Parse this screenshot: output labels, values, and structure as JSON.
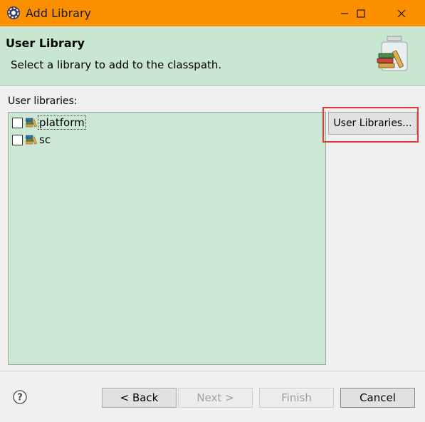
{
  "window": {
    "title": "Add Library",
    "controls": {
      "minimize": "minimize",
      "maximize": "maximize",
      "close": "close"
    },
    "titlebar_color": "#fb8f00"
  },
  "banner": {
    "title": "User Library",
    "description": "Select a library to add to the classpath.",
    "background": "#c8e6d0",
    "image_icon": "library-jar-icon"
  },
  "main": {
    "list_label": "User libraries:",
    "libraries": [
      {
        "label": "platform",
        "checked": false,
        "focused": true
      },
      {
        "label": "sc",
        "checked": false,
        "focused": false
      }
    ],
    "user_libraries_button": "User Libraries...",
    "highlight_color": "#e23a3a"
  },
  "footer": {
    "help_icon": "help-icon",
    "back": "< Back",
    "next": "Next >",
    "finish": "Finish",
    "cancel": "Cancel"
  }
}
